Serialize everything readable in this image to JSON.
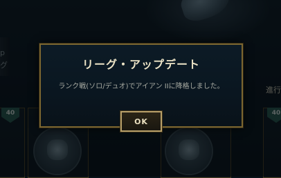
{
  "dialog": {
    "title": "リーグ・アップデート",
    "message": "ランク戦(ソロ/デュオ)でアイアン IIに降格しました。",
    "ok_label": "OK"
  },
  "background": {
    "left_text": "p\nグ",
    "right_label": "進行",
    "cards": [
      {
        "level": "40"
      },
      {
        "level": "40"
      }
    ]
  },
  "colors": {
    "dialog_border": "#7c6630",
    "dialog_bg": "#0a1620",
    "title_text": "#ece3c6",
    "message_text": "#a8aba3",
    "button_border": "#b8a06a",
    "level_badge": "#275449"
  },
  "icons": {
    "left_emblem": "rank-emblem-icon",
    "right_emblem": "rank-emblem-icon"
  }
}
